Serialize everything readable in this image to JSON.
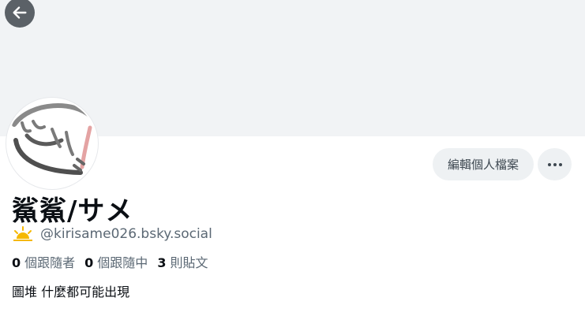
{
  "profile": {
    "display_name": "鯊鯊/サメ",
    "handle": "@kirisame026.bsky.social",
    "bio": "圖堆 什麼都可能出現",
    "edit_button_label": "編輯個人檔案",
    "stats": {
      "followers_count": "0",
      "followers_label": "個跟隨者",
      "following_count": "0",
      "following_label": "個跟隨中",
      "posts_count": "3",
      "posts_label": "則貼文"
    }
  },
  "icons": {
    "back": "back-arrow-icon",
    "more": "more-horizontal-icon",
    "handle_badge": "sunrise-icon"
  },
  "colors": {
    "banner": "#f1f3f5",
    "secondary_text": "#5b6874",
    "sunrise": "#f5b800"
  }
}
